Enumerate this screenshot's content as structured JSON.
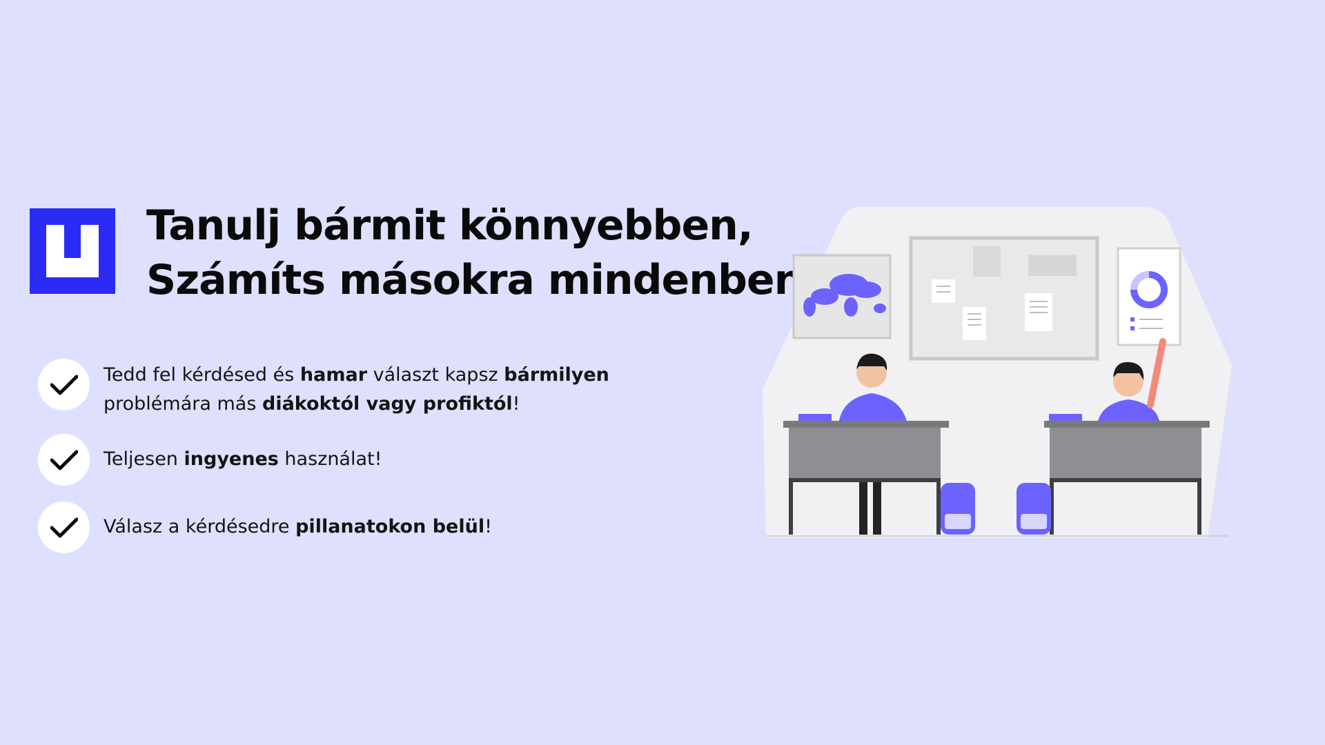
{
  "logo": {
    "icon": "brand-logo-icon",
    "color": "#2b2bf5"
  },
  "headline": {
    "line1": "Tanulj bármit könnyebben,",
    "line2": "Számíts másokra mindenben!"
  },
  "features": [
    {
      "icon": "check-icon",
      "line1": {
        "a": "Tedd fel kérdésed és ",
        "b": "hamar",
        "c": " választ kapsz ",
        "d": "bármilyen"
      },
      "line2": {
        "a": "problémára más ",
        "b": "diákoktól vagy profiktól",
        "c": "!"
      }
    },
    {
      "icon": "check-icon",
      "line1": {
        "a": "Teljesen ",
        "b": "ingyenes",
        "c": " használat!"
      }
    },
    {
      "icon": "check-icon",
      "line1": {
        "a": "Válasz a kérdésedre ",
        "b": "pillanatokon belül",
        "c": "!"
      }
    }
  ],
  "illustration": {
    "icon": "classroom-illustration",
    "accent": "#6c63ff",
    "background": "#f2f2f4"
  },
  "colors": {
    "background": "#dfe0fd",
    "text": "#0a0a0a"
  }
}
